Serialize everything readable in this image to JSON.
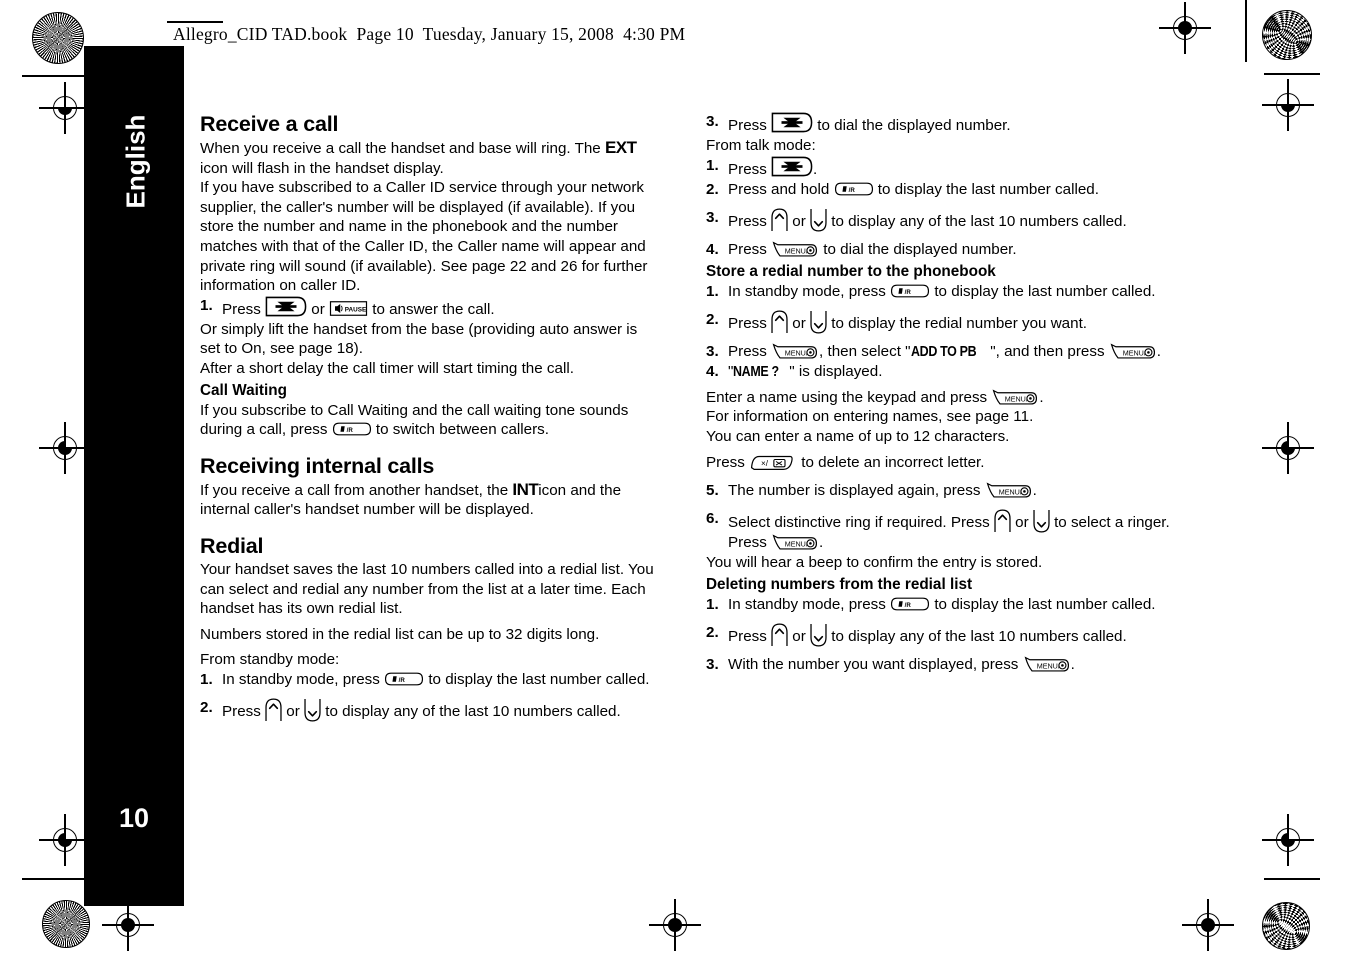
{
  "header": {
    "text": "Allegro_CID TAD.book  Page 10  Tuesday, January 15, 2008  4:30 PM"
  },
  "sidebar": {
    "language": "English",
    "page_number": "10"
  },
  "left_column": {
    "heading_receive_a_call": "Receive a call",
    "p1_a": "When you receive a call the handset and base will ring. The ",
    "p1_indicator": "EXT",
    "p1_b": " icon will flash in the handset display.",
    "p2": "If you have subscribed to a Caller ID service through your network supplier, the caller's number will be displayed (if available). If you store the number and name in the phonebook and the number matches with that of the Caller ID, the Caller name will appear and private ring will sound (if available). See page 22 and 26 for further information on caller ID.",
    "step1_num": "1.",
    "step1_a": "Press ",
    "step1_b": " or ",
    "step1_c": " to answer the call.",
    "p3": "Or simply lift the handset from the base (providing auto answer is set to On, see page 18).",
    "p4": "After a short delay the call timer will start timing the call.",
    "heading_call_waiting": "Call Waiting",
    "p5_a": "If you subscribe to Call Waiting and the call waiting tone sounds during a call, press ",
    "p5_b": " to switch between callers.",
    "heading_receiving_internal": "Receiving internal calls",
    "p6_a": "If you receive a call from another handset, the ",
    "p6_indicator": "INT",
    "p6_b": "icon and the internal caller's handset number will be displayed.",
    "heading_redial": "Redial",
    "p7": "Your handset saves the last 10 numbers called into a redial list. You can select and redial any number from the list at a later time. Each handset has its own redial list.",
    "p8": "Numbers stored in the redial list can be up to 32 digits long.",
    "p9": "From standby mode:",
    "step_s1_num": "1.",
    "step_s1_a": "In standby mode, press ",
    "step_s1_b": " to display the last number called.",
    "step_s2_num": "2.",
    "step_s2_a": "Press ",
    "step_s2_b": " or ",
    "step_s2_c": " to display any of the last 10 numbers called."
  },
  "right_column": {
    "step_r3_num": "3.",
    "step_r3_a": "Press ",
    "step_r3_b": " to dial the displayed number.",
    "p_from_talk": "From talk mode:",
    "step_t1_num": "1.",
    "step_t1_a": "Press ",
    "step_t1_b": ".",
    "step_t2_num": "2.",
    "step_t2_a": "Press and hold ",
    "step_t2_b": " to display the last number called.",
    "step_t3_num": "3.",
    "step_t3_a": "Press ",
    "step_t3_b": " or ",
    "step_t3_c": " to display any of the last 10 numbers called.",
    "step_t4_num": "4.",
    "step_t4_a": "Press ",
    "step_t4_b": " to dial the displayed number.",
    "heading_store_redial": "Store a redial number to the phonebook",
    "step_st1_num": "1.",
    "step_st1_a": "In standby mode, press ",
    "step_st1_b": " to display the last number called.",
    "step_st2_num": "2.",
    "step_st2_a": "Press ",
    "step_st2_b": " or ",
    "step_st2_c": " to display the redial number you want.",
    "step_st3_num": "3.",
    "step_st3_a": "Press ",
    "step_st3_b": ", then select \"",
    "step_st3_lcd": "ADD TO PB",
    "step_st3_c": "\", and then press ",
    "step_st3_d": ".",
    "step_st4_num": "4.",
    "step_st4_a": "\"",
    "step_st4_lcd": "NAME ?",
    "step_st4_b": "\" is displayed.",
    "p_enter_name_a": "Enter a name using the keypad and press ",
    "p_enter_name_b": ".",
    "p_info_names": "For information on entering names, see page 11.",
    "p_12_chars": "You can enter a name of up to 12 characters.",
    "p_delete_a": "Press ",
    "p_delete_b": " to delete an incorrect letter.",
    "step_st5_num": "5.",
    "step_st5_a": "The number is displayed again, press ",
    "step_st5_b": ".",
    "step_st6_num": "6.",
    "step_st6_a": "Select distinctive ring if required. Press ",
    "step_st6_b": " or ",
    "step_st6_c": " to select a ringer. Press ",
    "step_st6_d": ".",
    "p_beep_confirm": "You will hear a beep to confirm the entry is stored.",
    "heading_deleting": "Deleting numbers from the redial list",
    "step_d1_num": "1.",
    "step_d1_a": "In standby mode, press ",
    "step_d1_b": " to display the last number called.",
    "step_d2_num": "2.",
    "step_d2_a": "Press ",
    "step_d2_b": " or ",
    "step_d2_c": " to display any of the last 10 numbers called.",
    "step_d3_num": "3.",
    "step_d3_a": "With the number you want displayed, press ",
    "step_d3_b": "."
  },
  "key_glyphs": {
    "talk_key": "talk-key",
    "pause_key": "PAUSE",
    "flash_key": "#/R",
    "menu_key": "MENU/⊛",
    "delete_key": "×/⌧",
    "up_key": "up-arrow-key",
    "down_key": "down-arrow-key"
  },
  "colors": {
    "ink": "#000000",
    "paper": "#ffffff"
  }
}
